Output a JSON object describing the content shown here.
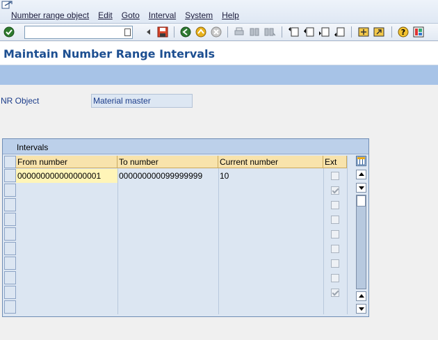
{
  "menu": {
    "items": [
      "Number range object",
      "Edit",
      "Goto",
      "Interval",
      "System",
      "Help"
    ]
  },
  "toolbar": {
    "command_field_value": "",
    "icons": [
      "enter-icon",
      "back-arrow-icon",
      "save-icon",
      "back-icon",
      "exit-icon",
      "cancel-icon",
      "print-icon",
      "find-icon",
      "find-next-icon",
      "first-page-icon",
      "previous-page-icon",
      "next-page-icon",
      "last-page-icon",
      "create-session-icon",
      "shortcut-icon",
      "help-icon",
      "customize-layout-icon"
    ]
  },
  "page": {
    "title": "Maintain Number Range Intervals"
  },
  "nr_object": {
    "label": "NR Object",
    "value": "Material master"
  },
  "intervals": {
    "caption": "Intervals",
    "columns": [
      "From number",
      "To number",
      "Current number",
      "Ext"
    ],
    "rows": [
      {
        "from": "000000000000000001",
        "to": "000000000099999999",
        "current": "10",
        "ext": false
      },
      {
        "from": "",
        "to": "",
        "current": "",
        "ext": true
      },
      {
        "from": "",
        "to": "",
        "current": "",
        "ext": false
      },
      {
        "from": "",
        "to": "",
        "current": "",
        "ext": false
      },
      {
        "from": "",
        "to": "",
        "current": "",
        "ext": false
      },
      {
        "from": "",
        "to": "",
        "current": "",
        "ext": false
      },
      {
        "from": "",
        "to": "",
        "current": "",
        "ext": false
      },
      {
        "from": "",
        "to": "",
        "current": "",
        "ext": false
      },
      {
        "from": "",
        "to": "",
        "current": "",
        "ext": true
      }
    ]
  },
  "colors": {
    "title": "#1d4f91",
    "app_toolbar": "#a7c3e7",
    "column_header": "#f8e3ac",
    "table_bg": "#dce6f2"
  }
}
